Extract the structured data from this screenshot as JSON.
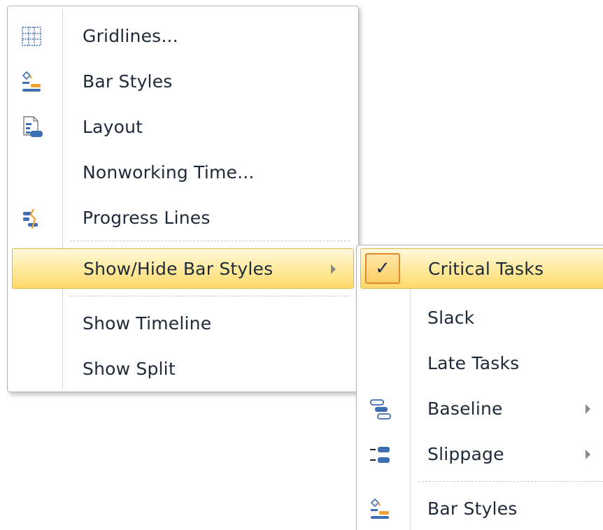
{
  "main_menu": {
    "items": [
      {
        "label": "Gridlines...",
        "icon": "gridlines-icon"
      },
      {
        "label": "Bar Styles",
        "icon": "bar-styles-icon"
      },
      {
        "label": "Layout",
        "icon": "layout-icon"
      },
      {
        "label": "Nonworking Time...",
        "icon": ""
      },
      {
        "label": "Progress Lines",
        "icon": "progress-lines-icon"
      },
      {
        "label": "Show/Hide Bar Styles",
        "icon": "",
        "submenu": true,
        "highlighted": true
      },
      {
        "label": "Show Timeline",
        "icon": ""
      },
      {
        "label": "Show Split",
        "icon": ""
      }
    ]
  },
  "sub_menu": {
    "items": [
      {
        "label": "Critical Tasks",
        "checked": true,
        "check_glyph": "✓",
        "highlighted": true
      },
      {
        "label": "Slack"
      },
      {
        "label": "Late Tasks"
      },
      {
        "label": "Baseline",
        "icon": "baseline-icon",
        "submenu": true
      },
      {
        "label": "Slippage",
        "icon": "slippage-icon",
        "submenu": true
      },
      {
        "label": "Bar Styles",
        "icon": "bar-styles-icon"
      }
    ]
  },
  "colors": {
    "highlight_border": "#e6b84a",
    "check_border": "#e38a2c",
    "text": "#1e2a3a",
    "icon_blue": "#3f6fb3",
    "icon_orange": "#f0a030"
  }
}
